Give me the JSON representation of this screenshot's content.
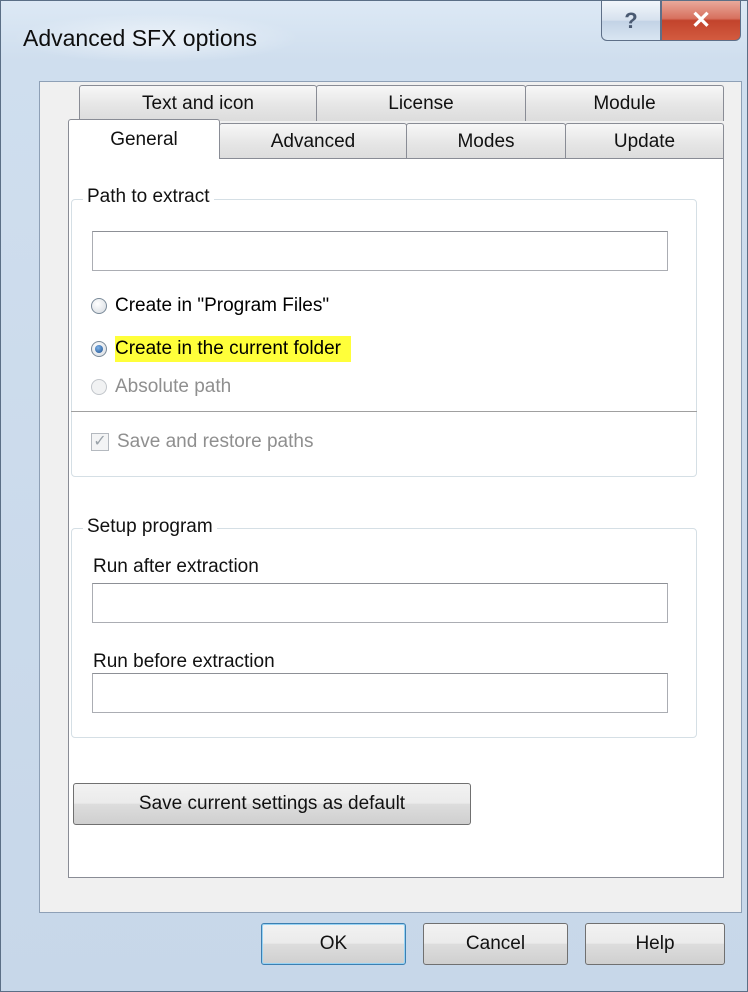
{
  "window": {
    "title": "Advanced SFX options",
    "help_glyph": "?",
    "close_glyph": "✕",
    "icons": {
      "help": "question-mark-icon",
      "close": "close-x-icon"
    },
    "colors": {
      "highlight": "#ffff3a",
      "close_button": "#c2432c"
    }
  },
  "tabs": {
    "row1": [
      {
        "label": "Text and icon"
      },
      {
        "label": "License"
      },
      {
        "label": "Module"
      }
    ],
    "row2": [
      {
        "label": "General",
        "active": true
      },
      {
        "label": "Advanced"
      },
      {
        "label": "Modes"
      },
      {
        "label": "Update"
      }
    ]
  },
  "path_group": {
    "legend": "Path to extract",
    "path_value": "",
    "options": [
      {
        "label": "Create in \"Program Files\"",
        "checked": false,
        "disabled": false
      },
      {
        "label": "Create in the current folder",
        "checked": true,
        "disabled": false,
        "highlighted": true
      },
      {
        "label": "Absolute path",
        "checked": false,
        "disabled": true
      }
    ],
    "save_restore": {
      "label": "Save and restore paths",
      "checked": true,
      "disabled": true,
      "check_glyph": "✓"
    }
  },
  "setup_group": {
    "legend": "Setup program",
    "run_after_label": "Run after extraction",
    "run_after_value": "",
    "run_before_label": "Run before extraction",
    "run_before_value": ""
  },
  "buttons": {
    "save_default": "Save current settings as default",
    "ok": "OK",
    "cancel": "Cancel",
    "help": "Help"
  }
}
